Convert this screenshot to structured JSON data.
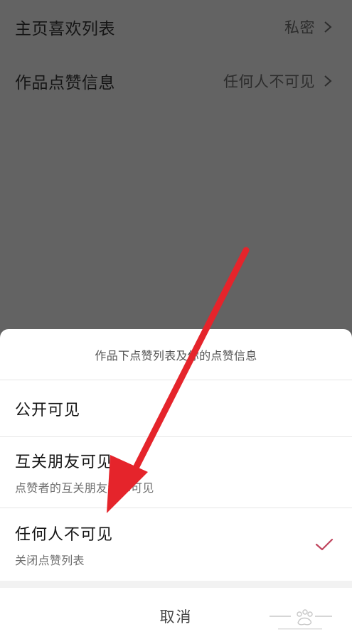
{
  "settings": {
    "rows": [
      {
        "label": "主页喜欢列表",
        "value": "私密"
      },
      {
        "label": "作品点赞信息",
        "value": "任何人不可见"
      }
    ]
  },
  "sheet": {
    "title": "作品下点赞列表及你的点赞信息",
    "options": [
      {
        "title": "公开可见",
        "description": "",
        "selected": false
      },
      {
        "title": "互关朋友可见",
        "description": "点赞者的互关朋友和你可见",
        "selected": false
      },
      {
        "title": "任何人不可见",
        "description": "关闭点赞列表",
        "selected": true
      }
    ],
    "cancel_label": "取消"
  },
  "colors": {
    "overlay": "#636363",
    "check": "#c0455e",
    "arrow": "#e5242b"
  },
  "watermark": {
    "text": "Baidu经验"
  }
}
